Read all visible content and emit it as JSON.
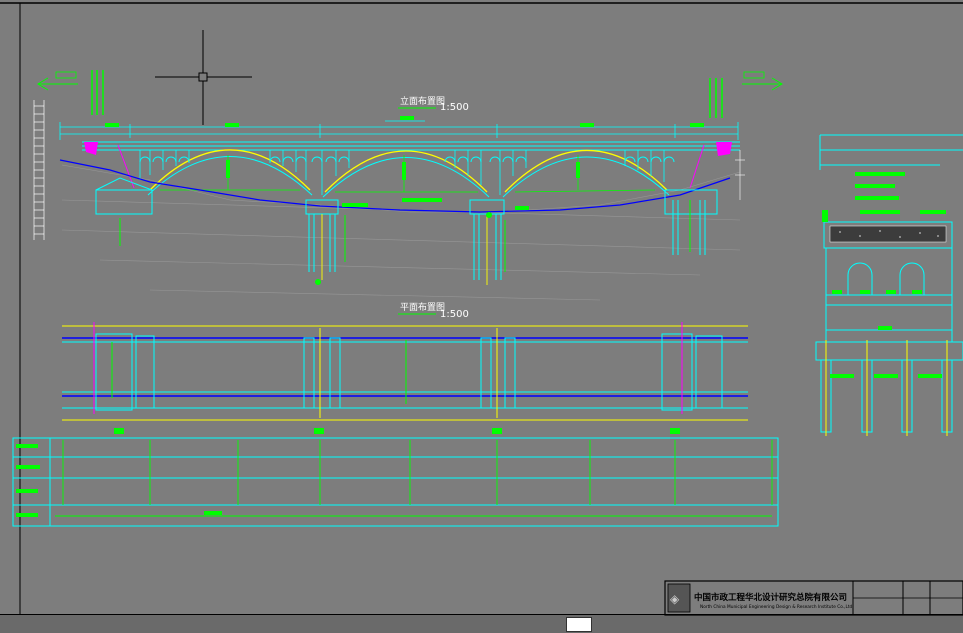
{
  "drawing": {
    "elevation": {
      "title": "立面布置图",
      "scale": "1:500"
    },
    "plan": {
      "title": "平面布置图",
      "scale": "1:500"
    },
    "title_block": {
      "company_cn": "中国市政工程华北设计研究总院有限公司",
      "company_en": "North China Municipal Engineering Design & Research Institute Co.,Ltd"
    }
  },
  "colors": {
    "background": "#7d7d7d",
    "frame": "#000000",
    "cyan": "#00ffff",
    "green": "#00ff00",
    "yellow": "#ffff00",
    "magenta": "#ff00ff",
    "blue": "#0000ff",
    "white": "#ffffff"
  },
  "icons": {
    "crosshair": "crosshair-cursor-icon",
    "left_arrow": "direction-arrow-left-icon",
    "right_arrow": "direction-arrow-right-icon",
    "logo": "company-logo-icon"
  }
}
